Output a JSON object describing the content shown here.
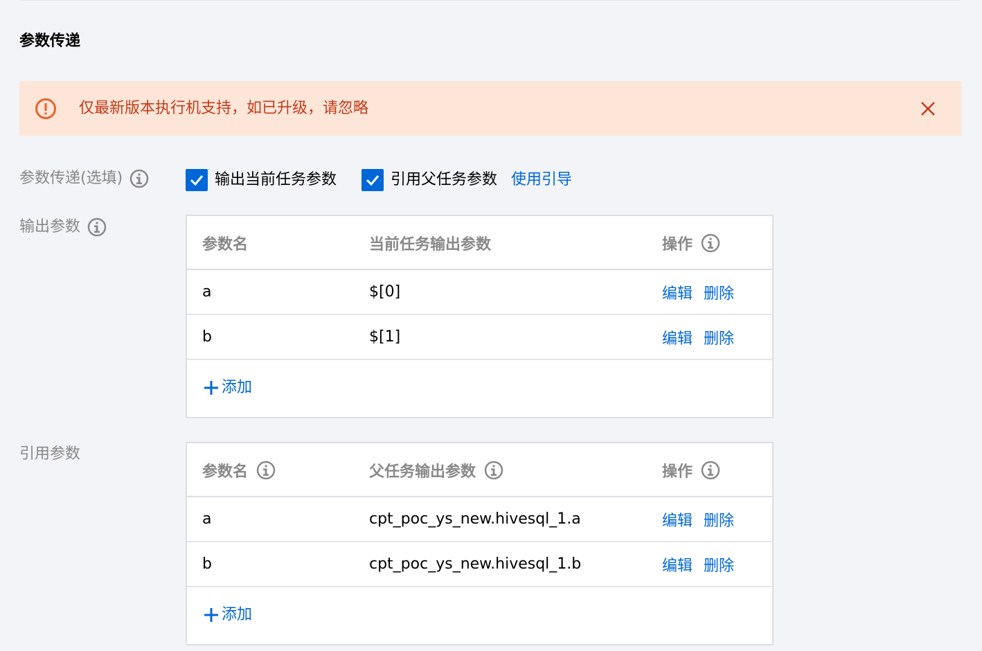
{
  "section": {
    "title": "参数传递"
  },
  "alert": {
    "text": "仅最新版本执行机支持，如已升级，请忽略",
    "color": "#c13c1b",
    "background": "#fde6d8",
    "icon": "warning-circle-icon",
    "close_icon": "close-icon"
  },
  "param_passing": {
    "label": "参数传递(选填)",
    "output_checkbox": {
      "label": "输出当前任务参数",
      "checked": true
    },
    "reference_checkbox": {
      "label": "引用父任务参数",
      "checked": true
    },
    "guide_link": "使用引导"
  },
  "output_params": {
    "label": "输出参数",
    "headers": {
      "name": "参数名",
      "value": "当前任务输出参数",
      "ops": "操作"
    },
    "rows": [
      {
        "name": "a",
        "value": "$[0]",
        "edit": "编辑",
        "delete": "删除"
      },
      {
        "name": "b",
        "value": "$[1]",
        "edit": "编辑",
        "delete": "删除"
      }
    ],
    "add_label": "添加"
  },
  "ref_params": {
    "label": "引用参数",
    "headers": {
      "name": "参数名",
      "value": "父任务输出参数",
      "ops": "操作"
    },
    "rows": [
      {
        "name": "a",
        "value": "cpt_poc_ys_new.hivesql_1.a",
        "edit": "编辑",
        "delete": "删除"
      },
      {
        "name": "b",
        "value": "cpt_poc_ys_new.hivesql_1.b",
        "edit": "编辑",
        "delete": "删除"
      }
    ],
    "add_label": "添加"
  },
  "colors": {
    "accent": "#0067d8",
    "muted_text": "#888888",
    "border": "#dcdee3"
  }
}
